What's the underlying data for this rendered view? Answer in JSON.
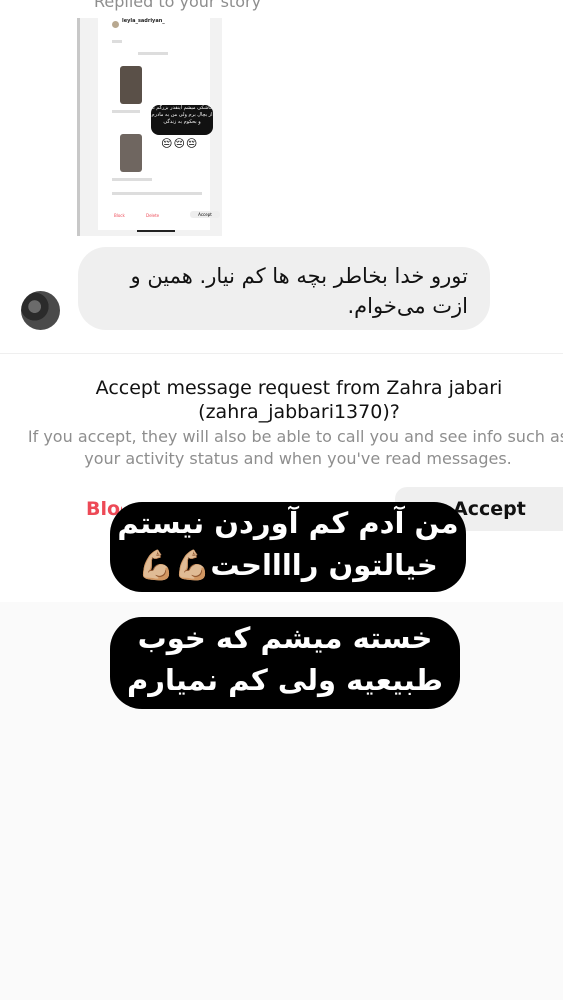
{
  "replied_label": "Replied to your story",
  "story_preview": {
    "username": "leyla_sadriyan_",
    "overlay_text": "کاشکی میشم اینقدر بزرگم تا از بچال برم ولی من به مادرم و بحکوم به زندگی",
    "emoji": "😔😔😔",
    "block": "Block",
    "delete": "Delete",
    "accept": "Accept",
    "photo_colors": [
      "#5a5048",
      "#6f6660"
    ]
  },
  "message": {
    "text": "تورو خدا بخاطر بچه ها کم نیار. همین و ازت می‌خوام."
  },
  "request": {
    "title": "Accept message request from Zahra jabari (zahra_jabbari1370)?",
    "subtitle": "If you accept, they will also be able to call you and see info such as your activity status and when you've read messages.",
    "block_label": "Block",
    "accept_label": "Accept"
  },
  "captions": {
    "first_line1": "من آدم کم آوردن نیستم",
    "first_line2": "خیالتون رااااحت💪🏼💪🏼",
    "second_line1": "خسته میشم که خوب",
    "second_line2": "طبیعیه ولی کم نمیارم"
  },
  "colors": {
    "block_red": "#ed4956",
    "bubble_gray": "#efefef",
    "caption_bg": "#000000"
  }
}
